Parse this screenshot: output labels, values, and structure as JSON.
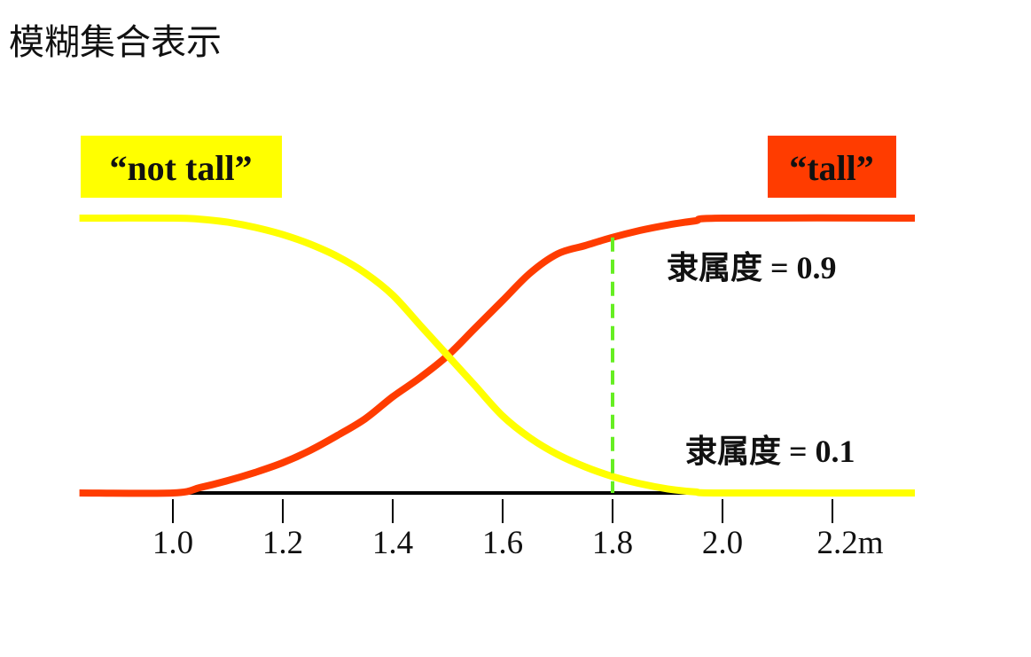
{
  "page_title": "模糊集合表示",
  "chart_data": {
    "type": "line",
    "x_unit": "m",
    "xlim": [
      0.83,
      2.35
    ],
    "ylim": [
      0,
      1
    ],
    "x_ticks": [
      1.0,
      1.2,
      1.4,
      1.6,
      1.8,
      2.0,
      2.2
    ],
    "x_tick_labels": [
      "1.0",
      "1.2",
      "1.4",
      "1.6",
      "1.8",
      "2.0",
      "2.2m"
    ],
    "series": [
      {
        "name": "“not tall”",
        "color": "#FFFF00",
        "x": [
          0.83,
          1.0,
          1.05,
          1.1,
          1.15,
          1.2,
          1.25,
          1.3,
          1.35,
          1.4,
          1.45,
          1.5,
          1.55,
          1.6,
          1.65,
          1.7,
          1.75,
          1.8,
          1.85,
          1.9,
          1.95,
          2.0,
          2.35
        ],
        "y": [
          1.0,
          1.0,
          0.996,
          0.985,
          0.966,
          0.94,
          0.905,
          0.86,
          0.8,
          0.72,
          0.61,
          0.5,
          0.39,
          0.28,
          0.2,
          0.14,
          0.095,
          0.06,
          0.034,
          0.015,
          0.004,
          0.0,
          0.0
        ]
      },
      {
        "name": "“tall”",
        "color": "#FF3C00",
        "x": [
          0.83,
          1.0,
          1.05,
          1.1,
          1.15,
          1.2,
          1.25,
          1.3,
          1.35,
          1.4,
          1.45,
          1.5,
          1.55,
          1.6,
          1.65,
          1.7,
          1.75,
          1.8,
          1.85,
          1.9,
          1.95,
          2.0,
          2.35
        ],
        "y": [
          0.0,
          0.0,
          0.02,
          0.045,
          0.075,
          0.11,
          0.155,
          0.21,
          0.27,
          0.35,
          0.42,
          0.5,
          0.6,
          0.7,
          0.8,
          0.87,
          0.9,
          0.93,
          0.955,
          0.975,
          0.99,
          1.0,
          1.0
        ]
      }
    ],
    "marker_x": 1.8,
    "marker_color": "#66EE22",
    "annotations": [
      {
        "text": "隶属度 = 0.9",
        "value": 0.9
      },
      {
        "text": "隶属度 = 0.1",
        "value": 0.1
      }
    ]
  }
}
